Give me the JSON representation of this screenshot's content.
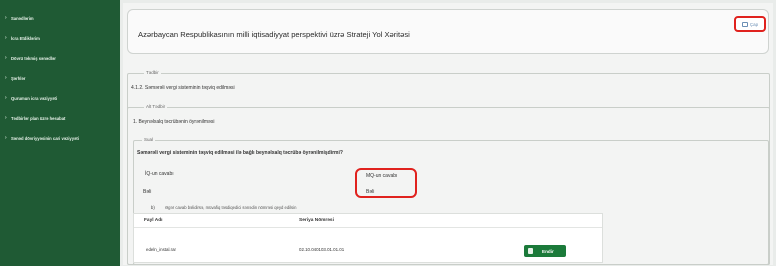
{
  "sidebar": {
    "items": [
      {
        "label": "Sanədlərim"
      },
      {
        "label": "İcra Etdiklərim"
      },
      {
        "label": "Dövrü təkmiş sənədlər"
      },
      {
        "label": "Şərhlər"
      },
      {
        "label": "Qurumun icra vəziyyəti"
      },
      {
        "label": "Tədbirlər plan üzrə hesabat"
      },
      {
        "label": "Sənəd dövriyyəsinin cari vəziyyəti"
      }
    ]
  },
  "header": {
    "title": "Azərbaycan Respublikasının milli iqtisadiyyat perspektivi üzrə Strateji Yol Xəritəsi",
    "print_label": "Çap"
  },
  "tedbir": {
    "legend": "Tədbir",
    "text": "4.1.2. Səmərəli vergi sisteminin təşviq edilməsi"
  },
  "alt_tedbir": {
    "legend": "Alt Tədbir",
    "text": "1. Beynəlxalq təcrübənin öyrənilməsi"
  },
  "sual": {
    "legend": "Sual",
    "question": "Səmərəli vergi sisteminin təşviq edilməsi ilə bağlı beynəlxalq təcrübə öyrənilmişdirmi?",
    "iq_label": "İQ-un cavabı",
    "mq_label": "MQ-un cavabı",
    "iq_value": "Bəli",
    "mq_value": "Bəli",
    "note_prefix": "b)",
    "note": "Əgər cavab bəlidirsə, müvafiq təsdiqedici sənədin nömrəsi qeyd edilsin"
  },
  "files": {
    "headers": [
      "Fayl Adı",
      "Seriya Nömrəsi"
    ],
    "rows": [
      {
        "name": "edeln_instal.rar",
        "serial": "02.10.040103.01.01.01",
        "download_label": "Endir"
      }
    ]
  }
}
